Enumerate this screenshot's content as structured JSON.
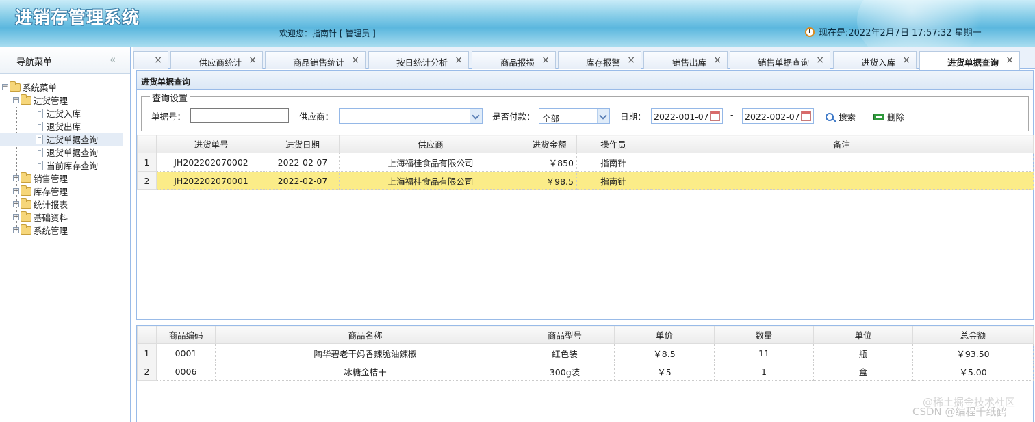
{
  "header": {
    "app_title": "进销存管理系统",
    "welcome": "欢迎您：指南针 [ 管理员 ]",
    "datetime": "现在是:2022年2月7日 17:57:32 星期一"
  },
  "nav": {
    "title": "导航菜单",
    "collapse": "«",
    "root": "系统菜单",
    "groups": [
      {
        "label": "进货管理",
        "expanded": true,
        "children": [
          "进货入库",
          "退货出库",
          "进货单据查询",
          "退货单据查询",
          "当前库存查询"
        ]
      },
      {
        "label": "销售管理",
        "expanded": false
      },
      {
        "label": "库存管理",
        "expanded": false
      },
      {
        "label": "统计报表",
        "expanded": false
      },
      {
        "label": "基础资料",
        "expanded": false
      },
      {
        "label": "系统管理",
        "expanded": false
      }
    ],
    "selected_item": "进货单据查询"
  },
  "tabs": [
    {
      "label": ""
    },
    {
      "label": "供应商统计"
    },
    {
      "label": "商品销售统计"
    },
    {
      "label": "按日统计分析"
    },
    {
      "label": "商品报损"
    },
    {
      "label": "库存报警"
    },
    {
      "label": "销售出库"
    },
    {
      "label": "销售单据查询"
    },
    {
      "label": "进货入库"
    },
    {
      "label": "进货单据查询",
      "active": true
    }
  ],
  "tab_close": "×",
  "panel_title": "进货单据查询",
  "query": {
    "legend": "查询设置",
    "order_no_label": "单据号：",
    "order_no_value": "",
    "supplier_label": "供应商：",
    "supplier_value": "",
    "paid_label": "是否付款：",
    "paid_value": "全部",
    "date_label": "日期：",
    "date_from": "2022-001-07",
    "date_sep": "-",
    "date_to": "2022-002-07",
    "search_label": "搜索",
    "delete_label": "删除"
  },
  "orders": {
    "columns": [
      "",
      "进货单号",
      "进货日期",
      "供应商",
      "进货金额",
      "操作员",
      "备注"
    ],
    "rows": [
      {
        "num": "1",
        "order_no": "JH202202070002",
        "date": "2022-02-07",
        "supplier": "上海福桂食品有限公司",
        "amount": "￥850",
        "operator": "指南针",
        "remark": ""
      },
      {
        "num": "2",
        "order_no": "JH202202070001",
        "date": "2022-02-07",
        "supplier": "上海福桂食品有限公司",
        "amount": "￥98.5",
        "operator": "指南针",
        "remark": ""
      }
    ],
    "selected_row": 1
  },
  "details": {
    "columns": [
      "",
      "商品编码",
      "商品名称",
      "商品型号",
      "单价",
      "数量",
      "单位",
      "总金额"
    ],
    "rows": [
      {
        "num": "1",
        "code": "0001",
        "name": "陶华碧老干妈香辣脆油辣椒",
        "model": "红色装",
        "price": "￥8.5",
        "qty": "11",
        "unit": "瓶",
        "total": "￥93.50"
      },
      {
        "num": "2",
        "code": "0006",
        "name": "冰糖金桔干",
        "model": "300g装",
        "price": "￥5",
        "qty": "1",
        "unit": "盒",
        "total": "￥5.00"
      }
    ]
  },
  "watermarks": [
    "@稀土掘金技术社区",
    "CSDN @编程千纸鹤"
  ]
}
